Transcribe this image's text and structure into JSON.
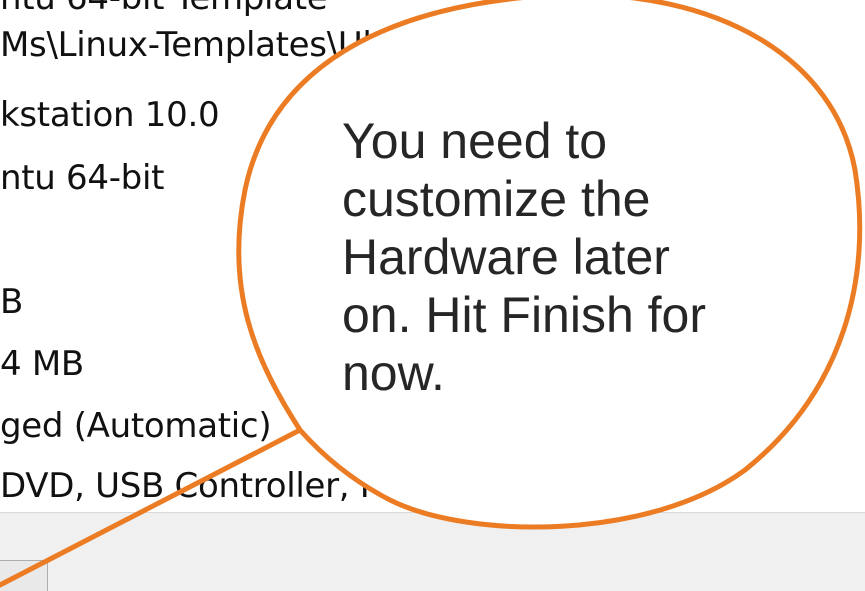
{
  "summary": {
    "rows": [
      {
        "text": "ntu 64-bit Template"
      },
      {
        "text": "Ms\\Linux-Templates\\Ubuntu 64-bit Template"
      },
      {
        "text": "kstation 10.0"
      },
      {
        "text": "ntu 64-bit"
      },
      {
        "text": ""
      },
      {
        "text": "B"
      },
      {
        "text": "4 MB"
      },
      {
        "text": "ged (Automatic)"
      },
      {
        "text": "DVD, USB Controller, Printer, Sound Card"
      }
    ]
  },
  "callout": {
    "text": "You need to\ncustomize the\nHardware later\non. Hit Finish for\nnow.",
    "fill_color": "#ffffff",
    "border_color": "#ec7c24"
  },
  "footer": {
    "button_label": ""
  }
}
